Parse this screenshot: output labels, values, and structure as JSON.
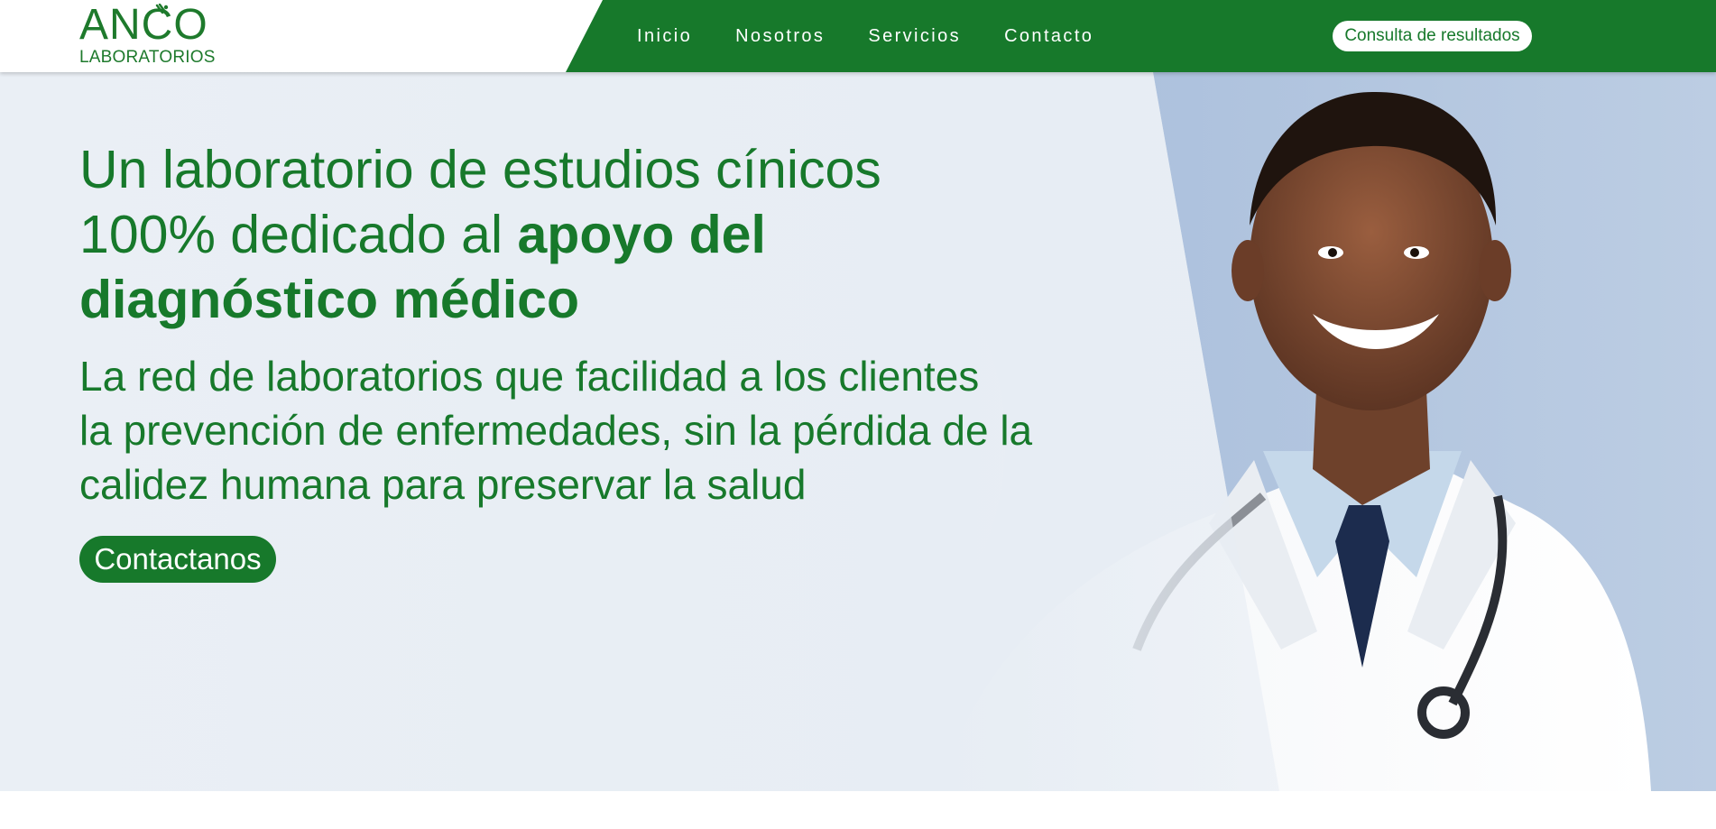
{
  "brand": {
    "name": "ANCO",
    "subtitle": "LABORATORIOS",
    "green": "#17792b",
    "icon": "flask-icon"
  },
  "nav": {
    "items": [
      {
        "label": "Inicio"
      },
      {
        "label": "Nosotros"
      },
      {
        "label": "Servicios"
      },
      {
        "label": "Contacto"
      }
    ],
    "results_button": "Consulta de resultados"
  },
  "hero": {
    "headline_line1": "Un laboratorio de estudios cínicos",
    "headline_line2_regular": "100% dedicado al ",
    "headline_line2_bold": "apoyo del",
    "headline_line3_bold": "diagnóstico médico",
    "sub_line1": "La red de laboratorios que facilidad a los clientes",
    "sub_line2": "la prevención de enfermedades, sin la pérdida de la",
    "sub_line3": "calidez humana para preservar la salud",
    "cta_label": "Contactanos",
    "image": "smiling-doctor-photo"
  }
}
